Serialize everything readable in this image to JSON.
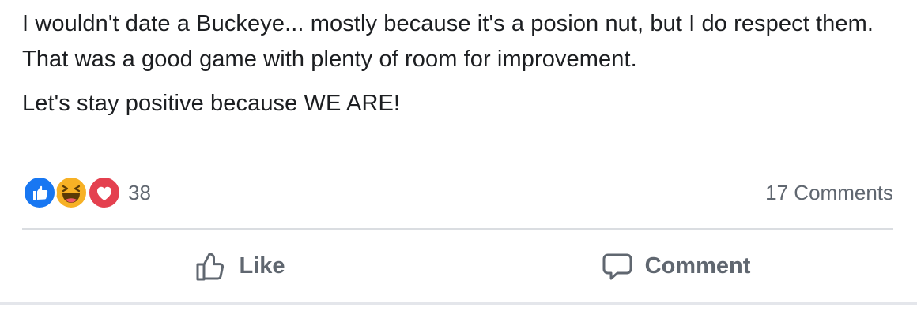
{
  "post": {
    "paragraphs": [
      "I wouldn't date a Buckeye... mostly because it's a posion nut, but I do respect them. That was a good game with plenty of room for improvement.",
      "Let's stay positive because WE ARE!"
    ]
  },
  "reactions": {
    "icons": [
      "like-icon",
      "haha-icon",
      "love-icon"
    ],
    "count": "38"
  },
  "comments": {
    "count_label": "17 Comments"
  },
  "actions": {
    "like_label": "Like",
    "comment_label": "Comment"
  },
  "colors": {
    "like_blue": "#1877f2",
    "haha_yellow": "#f7b125",
    "love_red": "#e4404f",
    "muted_text": "#606770"
  }
}
